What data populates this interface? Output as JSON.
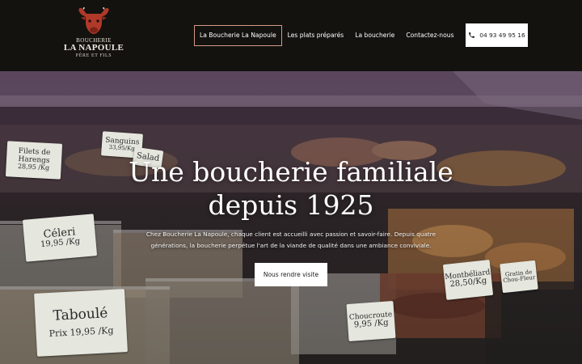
{
  "brand": {
    "line1": "BOUCHERIE",
    "line2": "LA NAPOULE",
    "line3": "PÈRE ET FILS",
    "accent": "#c0392b"
  },
  "nav": {
    "items": [
      {
        "label": "La Boucherie La Napoule",
        "active": true
      },
      {
        "label": "Les plats préparés",
        "active": false
      },
      {
        "label": "La boucherie",
        "active": false
      },
      {
        "label": "Contactez-nous",
        "active": false
      }
    ],
    "active_border": "#d39a86"
  },
  "phone": {
    "icon": "phone-icon",
    "number": "04 93 49 95 16"
  },
  "hero": {
    "title_line1": "Une boucherie familiale",
    "title_line2": "depuis 1925",
    "description": "Chez Boucherie La Napoule, chaque client est accueilli avec passion et savoir-faire. Depuis quatre générations, la boucherie perpétue l'art de la viande de qualité dans une ambiance conviviale.",
    "cta_label": "Nous rendre visite"
  },
  "background_tags": [
    {
      "name": "Filets de Harengs",
      "line1": "Filets de",
      "line2": "Harengs",
      "price": "28,95 /Kg"
    },
    {
      "name": "Sanguins",
      "line1": "Sanguins",
      "line2": "",
      "price": "33,95/Kg"
    },
    {
      "name": "Salade",
      "line1": "Salad",
      "line2": "",
      "price": ""
    },
    {
      "name": "Céleri",
      "line1": "Céleri",
      "line2": "",
      "price": "19,95 /Kg"
    },
    {
      "name": "Taboulé",
      "line1": "Taboulé",
      "line2": "",
      "price": "Prix 19,95 /Kg"
    },
    {
      "name": "Montbéliard",
      "line1": "Montbéliard",
      "line2": "",
      "price": "28,50/Kg"
    },
    {
      "name": "Choucroute",
      "line1": "Choucroute",
      "line2": "",
      "price": "9,95 /Kg"
    },
    {
      "name": "Gratin de Chou-Fleur",
      "line1": "Gratin de",
      "line2": "Chou-Fleur",
      "price": ""
    }
  ]
}
